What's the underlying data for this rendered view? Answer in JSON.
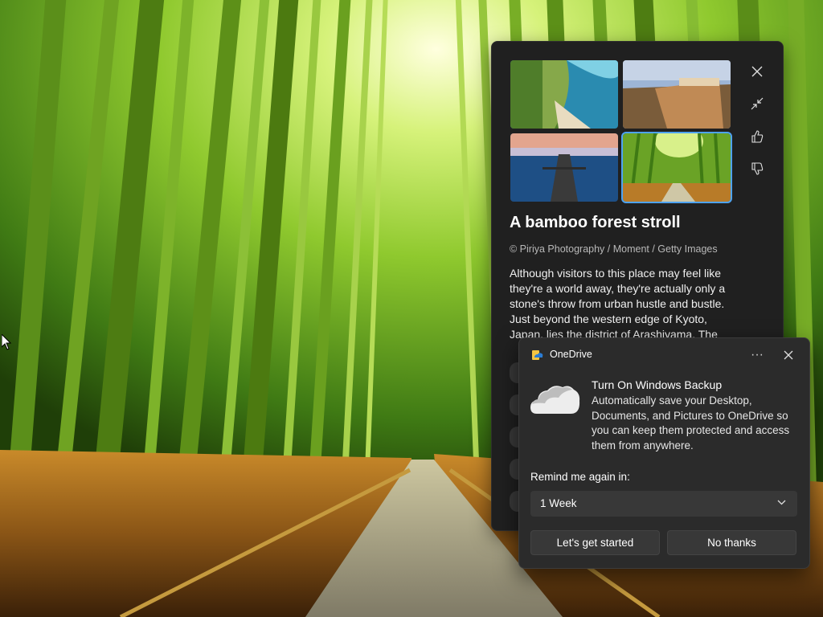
{
  "spotlight": {
    "title": "A bamboo forest stroll",
    "credit": "© Piriya Photography / Moment / Getty Images",
    "description": "Although visitors to this place may feel like they're a world away, they're actually only a stone's throw from urban hustle and bustle. Just beyond the western edge of Kyoto, Japan, lies the district of Arashiyama. The",
    "thumbnails": [
      {
        "name": "coastal-cliff"
      },
      {
        "name": "cliff-town"
      },
      {
        "name": "pier-sunset"
      },
      {
        "name": "bamboo-forest",
        "selected": true
      }
    ],
    "actions": [
      "close-icon",
      "minimize-icon",
      "like-icon",
      "dislike-icon"
    ]
  },
  "toast": {
    "app_name": "OneDrive",
    "heading": "Turn On Windows Backup",
    "body": "Automatically save your Desktop, Documents, and Pictures to OneDrive so you can keep them protected and access them from anywhere.",
    "remind_label": "Remind me again in:",
    "remind_value": "1 Week",
    "primary_button": "Let's get started",
    "secondary_button": "No thanks",
    "more_label": "···"
  },
  "colors": {
    "accent": "#4ea3f2",
    "flyout_bg": "#202020",
    "toast_bg": "#2b2b2b",
    "onedrive_blue": "#2b7cd3"
  }
}
